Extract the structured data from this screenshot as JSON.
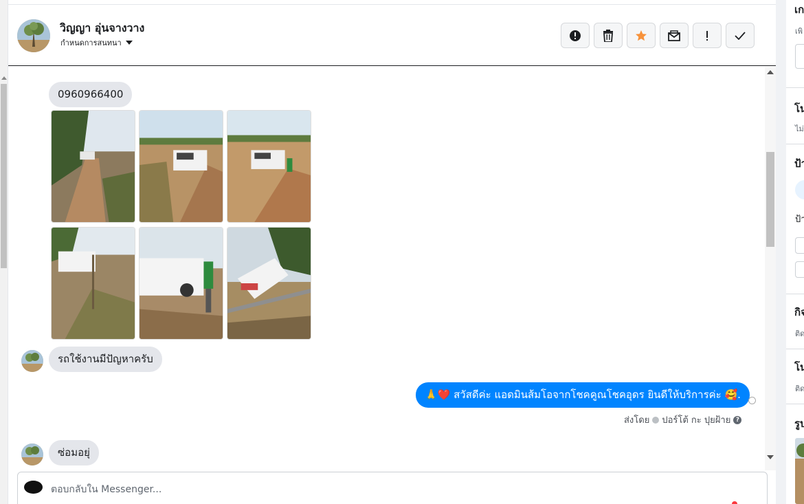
{
  "header": {
    "contact_name": "วิญญา อุ่นจางวาง",
    "assign_label": "กำหนดการสนทนา",
    "actions": [
      {
        "name": "spam-button",
        "icon": "alert-circle-icon"
      },
      {
        "name": "delete-button",
        "icon": "trash-icon"
      },
      {
        "name": "follow-up-button",
        "icon": "star-icon",
        "color": "#f7923b"
      },
      {
        "name": "mark-unread-button",
        "icon": "envelope-icon"
      },
      {
        "name": "priority-button",
        "icon": "exclamation-icon"
      },
      {
        "name": "mark-done-button",
        "icon": "check-icon"
      }
    ]
  },
  "messages": {
    "phone": "0960966400",
    "incoming_1": "รถใช้งานมีปัญหาครับ",
    "outgoing_1": "🙏❤️ สวัสดีค่ะ แอดมินส้มโอจากโชคคูณโชคอุดร ยินดีให้บริการค่ะ 🥰.",
    "sent_by_prefix": "ส่งโดย",
    "sent_by_name": "ปอร์โต้ กะ ปุยฝ้าย",
    "incoming_2": "ซ่อมอยุ่"
  },
  "composer": {
    "placeholder": "ตอบกลับใน Messenger..."
  },
  "right_panel": {
    "sections": [
      {
        "title": "เก",
        "sub": "เพิ"
      },
      {
        "title": "โน",
        "sub": "ไม่"
      },
      {
        "title": "ป้า",
        "sub": ""
      },
      {
        "title": "กิจ",
        "sub": "ติด"
      },
      {
        "title": "โน",
        "sub": "ติด"
      },
      {
        "title": "รูป",
        "sub": ""
      }
    ],
    "label_sub": "ป้า"
  },
  "colors": {
    "accent": "#0084ff",
    "incoming_bubble": "#e4e6eb",
    "star": "#f7923b"
  }
}
